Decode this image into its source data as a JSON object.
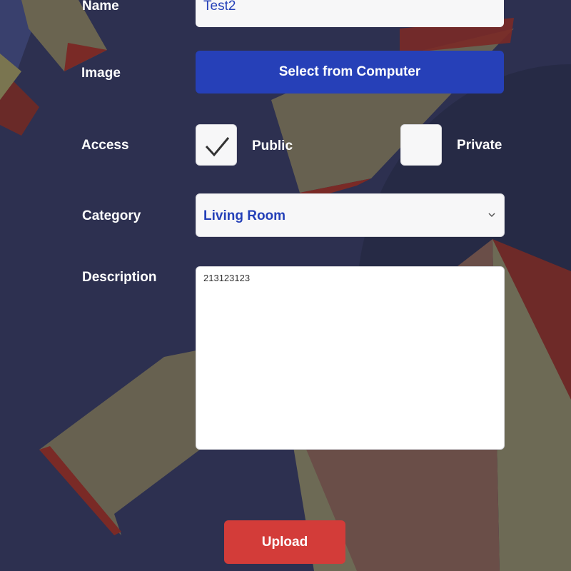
{
  "form": {
    "name_label": "Name",
    "name_value": "Test2",
    "image_label": "Image",
    "select_button_label": "Select from Computer",
    "access_label": "Access",
    "access_options": [
      {
        "label": "Public",
        "checked": true
      },
      {
        "label": "Private",
        "checked": false
      }
    ],
    "category_label": "Category",
    "category_value": "Living Room",
    "description_label": "Description",
    "description_value": "213123123",
    "upload_button_label": "Upload"
  },
  "icons": {
    "checkmark": "check-icon",
    "dropdown": "chevron-down-icon"
  },
  "colors": {
    "background": "#2d3050",
    "primary_button": "#2640b8",
    "upload_button": "#d33c39",
    "field_text": "#2440b8"
  }
}
